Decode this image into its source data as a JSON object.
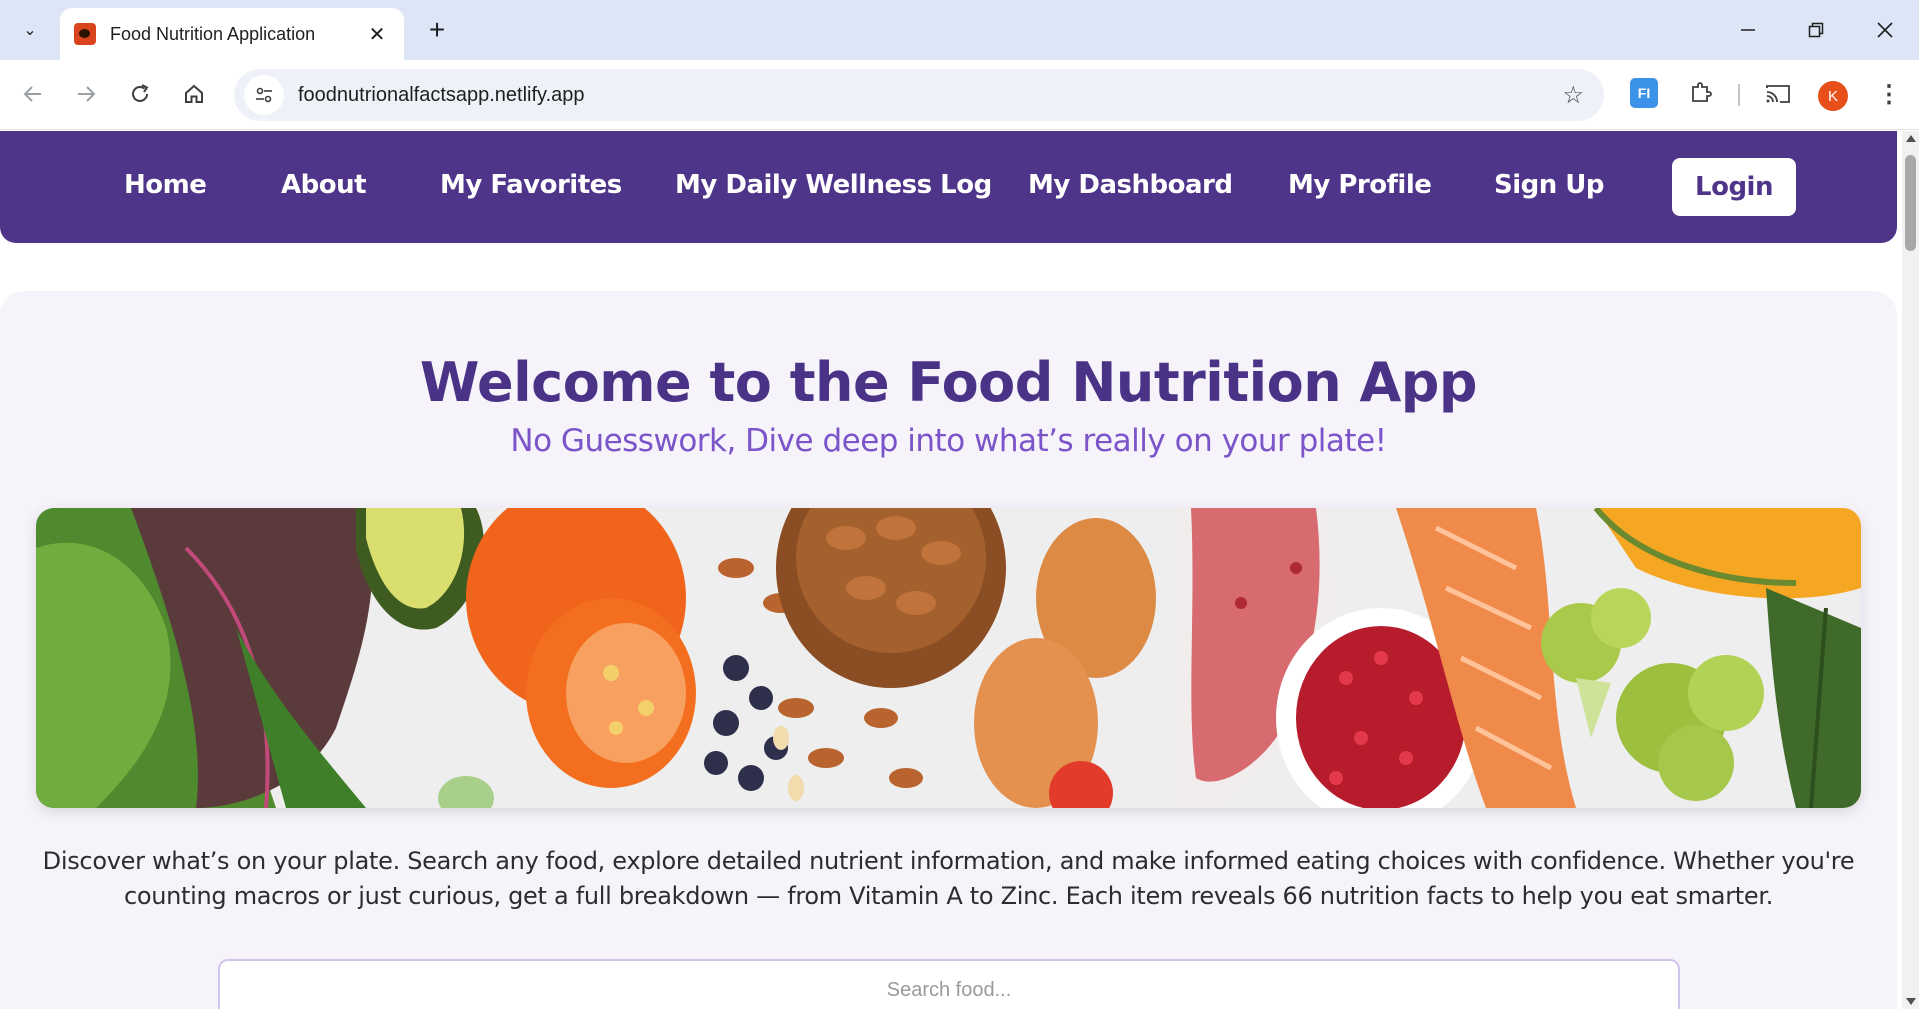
{
  "browser": {
    "tab_title": "Food Nutrition Application",
    "url": "foodnutrionalfactsapp.netlify.app",
    "profile_initial": "K",
    "extension_label": "FI"
  },
  "navbar": {
    "links": [
      "Home",
      "About",
      "My Favorites",
      "My Daily Wellness Log",
      "My Dashboard",
      "My Profile",
      "Sign Up"
    ],
    "login_label": "Login",
    "background": "#4f358a"
  },
  "hero": {
    "title": "Welcome to the Food Nutrition App",
    "subtitle": "No Guesswork, Dive deep into what’s really on your plate!"
  },
  "description": "Discover what’s on your plate. Search any food, explore detailed nutrient information, and make informed eating choices with confidence. Whether you're counting macros or just curious, get a full breakdown — from Vitamin A to Zinc. Each item reveals 66 nutrition facts to help you eat smarter.",
  "search": {
    "placeholder": "Search food..."
  },
  "colors": {
    "primary": "#4f358a",
    "title": "#4a3387",
    "subtitle": "#7b54c9",
    "page_bg": "#f6f4fa"
  }
}
